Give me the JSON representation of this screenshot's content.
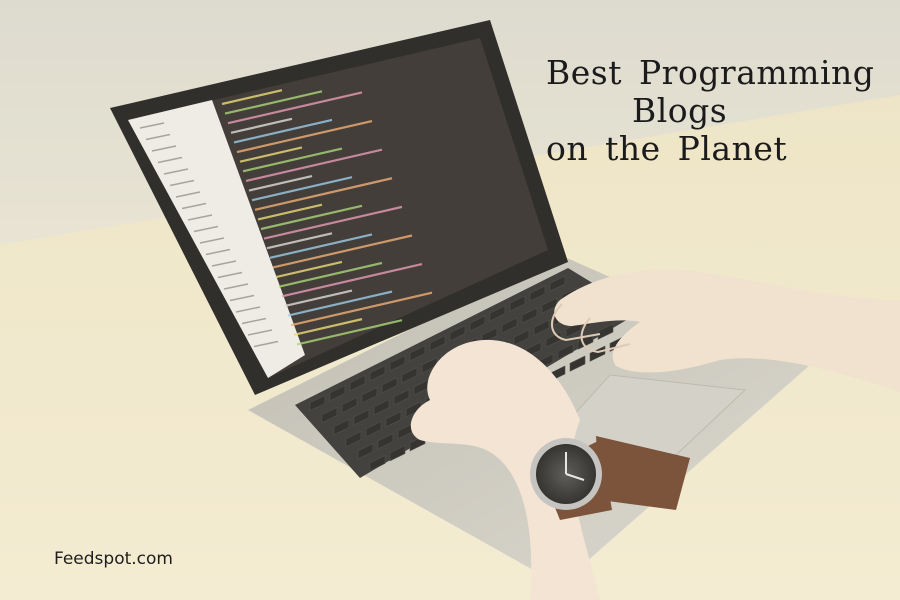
{
  "headline": {
    "line1": "Best Programming",
    "line2": "Blogs",
    "line3": "on the Planet"
  },
  "brand": {
    "name": "Feedspot.com"
  },
  "colors": {
    "wall": "#dcdcd2",
    "desk": "#efe6c9",
    "laptop_body": "#c8c6bf",
    "screen_bezel": "#151515",
    "editor_bg": "#2a2526",
    "keys": "#222222",
    "skin": "#f1e1d2",
    "watch_strap": "#6a3d26"
  },
  "icons": {
    "watch": "wristwatch-icon"
  }
}
